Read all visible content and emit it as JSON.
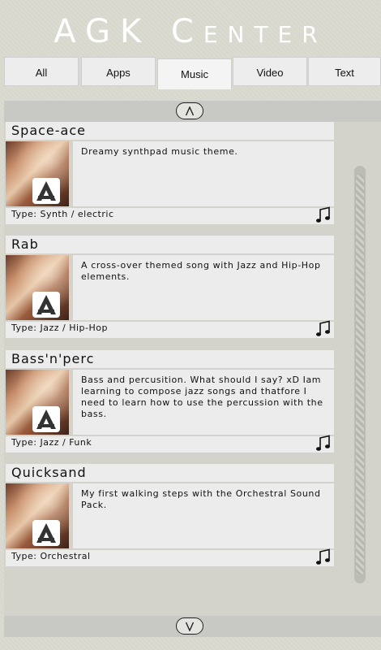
{
  "app": {
    "title": "AGK Center"
  },
  "tabs": [
    {
      "label": "All"
    },
    {
      "label": "Apps"
    },
    {
      "label": "Music",
      "active": true
    },
    {
      "label": "Video"
    },
    {
      "label": "Text"
    }
  ],
  "icons": {
    "scroll_up": "chevron-up-icon",
    "scroll_down": "chevron-down-icon",
    "item_type": "music-note-icon",
    "thumbnail_logo": "agk-logo"
  },
  "items": [
    {
      "title": "Space-ace",
      "description": "Dreamy synthpad music theme.",
      "type": "Type: Synth / electric"
    },
    {
      "title": "Rab",
      "description": "A cross-over themed song with Jazz and Hip-Hop elements.",
      "type": "Type: Jazz / Hip-Hop"
    },
    {
      "title": "Bass'n'perc",
      "description": "Bass and percusition. What should I say? xD Iam learning to compose jazz songs and thatfore I need to learn how to use the percussion with the bass.",
      "type": "Type: Jazz / Funk"
    },
    {
      "title": "Quicksand",
      "description": "My first walking steps with the Orchestral Sound Pack.",
      "type": "Type: Orchestral"
    }
  ]
}
